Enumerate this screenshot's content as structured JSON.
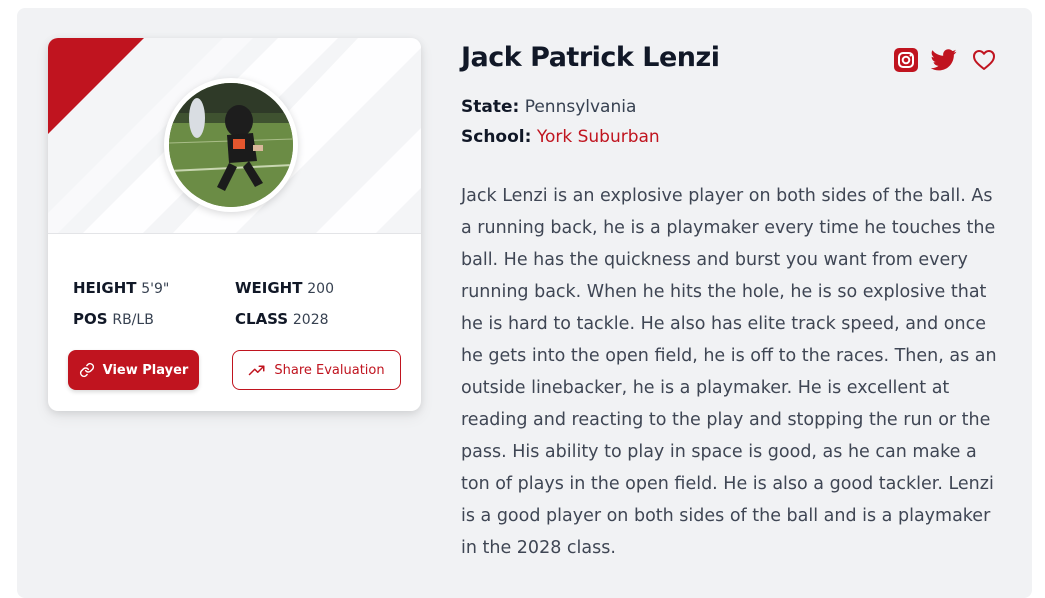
{
  "player": {
    "name": "Jack Patrick Lenzi",
    "state_label": "State:",
    "state": "Pennsylvania",
    "school_label": "School:",
    "school": "York Suburban",
    "bio": "Jack Lenzi is an explosive player on both sides of the ball. As a running back, he is a playmaker every time he touches the ball. He has the quickness and burst you want from every running back. When he hits the hole, he is so explosive that he is hard to tackle. He also has elite track speed, and once he gets into the open field, he is off to the races. Then, as an outside linebacker, he is a playmaker. He is excellent at reading and reacting to the play and stopping the run or the pass. His ability to play in space is good, as he can make a ton of plays in the open field. He is also a good tackler. Lenzi is a good player on both sides of the ball and is a playmaker in the 2028 class."
  },
  "card": {
    "stats": {
      "height_label": "HEIGHT",
      "height": "5'9\"",
      "weight_label": "WEIGHT",
      "weight": "200",
      "pos_label": "POS",
      "pos": "RB/LB",
      "class_label": "CLASS",
      "class": "2028"
    },
    "view_button": "View Player",
    "share_button": "Share Evaluation"
  },
  "icons": {
    "social": [
      "instagram-icon",
      "twitter-icon",
      "heart-icon"
    ],
    "view": "link-icon",
    "share": "trending-up-icon"
  },
  "colors": {
    "accent": "#c0141f",
    "text_dark": "#111827",
    "body_text": "#3f4654",
    "panel_bg": "#f1f2f4"
  }
}
